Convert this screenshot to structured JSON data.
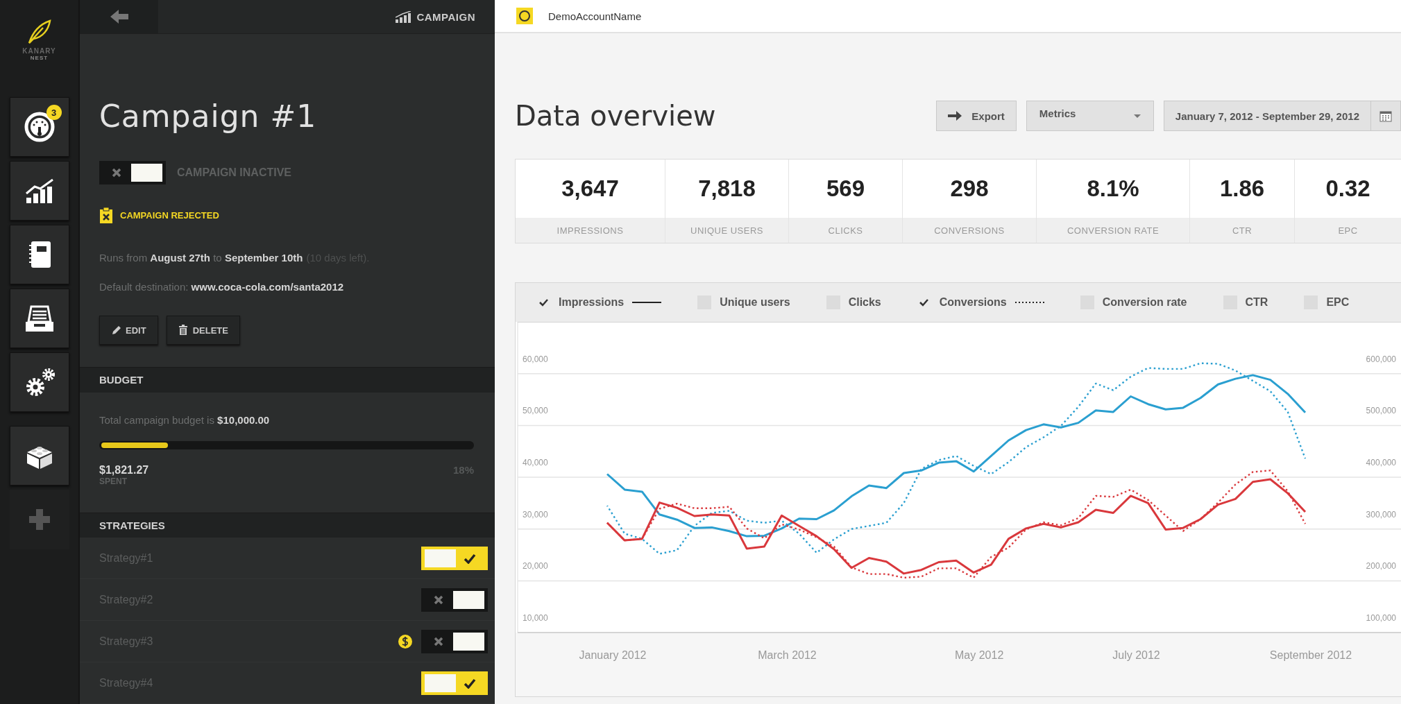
{
  "logo": {
    "line1": "KANARY",
    "line2": "NEST"
  },
  "nav": [
    {
      "kind": "dashboard",
      "badge": "3"
    },
    {
      "kind": "chart"
    },
    {
      "kind": "notebook"
    },
    {
      "kind": "inbox"
    },
    {
      "kind": "settings"
    },
    {
      "kind": "blocks"
    },
    {
      "kind": "add"
    }
  ],
  "panel": {
    "header_title": "CAMPAIGN",
    "title": "Campaign #1",
    "status": {
      "on": false,
      "label": "CAMPAIGN INACTIVE"
    },
    "rejected": "CAMPAIGN REJECTED",
    "runs": "Runs from **August 27th** to **September 10th**",
    "days_left": "(10 days left).",
    "destination": "Default destination: **www.coca-cola.com/santa2012**",
    "buttons": [
      {
        "kind": "edit",
        "label": "EDIT"
      },
      {
        "kind": "delete",
        "label": "DELETE"
      }
    ],
    "budget": {
      "heading": "BUDGET",
      "text": "Total campaign budget is **$10,000.00**",
      "level": 0.18,
      "spent": "$1,821.27",
      "spent_label": "SPENT",
      "percent": "18%"
    },
    "strategies_heading": "STRATEGIES",
    "strategies": [
      {
        "name": "Strategy#1",
        "on": true,
        "coin": false
      },
      {
        "name": "Strategy#2",
        "on": false,
        "coin": false
      },
      {
        "name": "Strategy#3",
        "on": false,
        "coin": true
      },
      {
        "name": "Strategy#4",
        "on": true,
        "coin": false
      }
    ]
  },
  "account": {
    "name": "DemoAccountName"
  },
  "overview": {
    "title": "Data overview",
    "export": "Export",
    "metrics": "Metrics",
    "date_range": "January 7, 2012 - September 29, 2012"
  },
  "stats": [
    {
      "value": "3,647",
      "label": "IMPRESSIONS"
    },
    {
      "value": "7,818",
      "label": "UNIQUE USERS"
    },
    {
      "value": "569",
      "label": "CLICKS"
    },
    {
      "value": "298",
      "label": "CONVERSIONS"
    },
    {
      "value": "8.1%",
      "label": "CONVERSION RATE"
    },
    {
      "value": "1.86",
      "label": "CTR"
    },
    {
      "value": "0.32",
      "label": "EPC"
    }
  ],
  "legend": [
    {
      "label": "Impressions",
      "checked": true,
      "kind": "solid"
    },
    {
      "label": "Unique users",
      "checked": false,
      "kind": "plain"
    },
    {
      "label": "Clicks",
      "checked": false,
      "kind": "plain"
    },
    {
      "label": "Conversions",
      "checked": true,
      "kind": "dotted"
    },
    {
      "label": "Conversion rate",
      "checked": false,
      "kind": "plain"
    },
    {
      "label": "CTR",
      "checked": false,
      "kind": "plain"
    },
    {
      "label": "EPC",
      "checked": false,
      "kind": "plain"
    }
  ],
  "right_axis_labels": [
    "600,000",
    "500,000",
    "400,000",
    "300,000",
    "200,000",
    "100,000"
  ],
  "chart_data": {
    "type": "line",
    "categories": [
      "January 2012",
      null,
      null,
      null,
      null,
      null,
      null,
      null,
      null,
      null,
      "March 2012",
      null,
      null,
      null,
      null,
      null,
      null,
      null,
      null,
      null,
      null,
      "May 2012",
      null,
      null,
      null,
      null,
      null,
      null,
      null,
      null,
      "July 2012",
      null,
      null,
      null,
      null,
      null,
      null,
      null,
      null,
      null,
      "September 2012"
    ],
    "ylim": [
      7200,
      67200
    ],
    "yticks": [
      {
        "value": 60000,
        "label": "60,000"
      },
      {
        "value": 50000,
        "label": "50,000"
      },
      {
        "value": 40000,
        "label": "40,000"
      },
      {
        "value": 30000,
        "label": "30,000"
      },
      {
        "value": 20000,
        "label": "20,000"
      },
      {
        "value": 10000,
        "label": "10,000"
      }
    ],
    "series": [
      {
        "color": "#2a9fd0",
        "line_style": "solid",
        "values": [
          37800,
          34800,
          34400,
          30000,
          29000,
          27400,
          27500,
          26800,
          25800,
          25900,
          27300,
          29200,
          29100,
          30800,
          33500,
          35600,
          35100,
          38000,
          38500,
          40000,
          40300,
          38300,
          41300,
          44300,
          46300,
          47400,
          46800,
          47700,
          50100,
          49800,
          52800,
          51300,
          50300,
          50600,
          52500,
          55100,
          56200,
          56900,
          56000,
          53300,
          49700
        ]
      },
      {
        "color": "#2a9fd0",
        "line_style": "dotted",
        "values": [
          31700,
          26300,
          25300,
          22400,
          23100,
          27800,
          30300,
          30700,
          28800,
          28400,
          28800,
          26300,
          22600,
          25200,
          27200,
          27800,
          28400,
          32200,
          38800,
          40500,
          41300,
          39400,
          37800,
          40100,
          43000,
          44900,
          47100,
          50800,
          55300,
          54000,
          56600,
          58300,
          58100,
          58100,
          59200,
          59100,
          57800,
          55800,
          53800,
          49800,
          40800
        ]
      },
      {
        "color": "#d9383c",
        "line_style": "solid",
        "values": [
          28400,
          25000,
          25300,
          32300,
          31300,
          29700,
          30000,
          29800,
          23400,
          23800,
          29800,
          27800,
          25800,
          23300,
          19700,
          21600,
          20900,
          18600,
          19300,
          20800,
          21100,
          18800,
          20300,
          25300,
          27300,
          28200,
          27500,
          28500,
          30900,
          30300,
          33600,
          32200,
          27100,
          27400,
          29100,
          31900,
          33000,
          36300,
          36800,
          34100,
          30500
        ]
      },
      {
        "color": "#d9383c",
        "line_style": "dotted",
        "values": [
          28400,
          25000,
          25300,
          31100,
          32100,
          31200,
          31200,
          31500,
          27300,
          25400,
          28100,
          27100,
          25600,
          23800,
          19800,
          18500,
          18500,
          17800,
          18000,
          19600,
          19600,
          17800,
          21800,
          23600,
          27100,
          28500,
          27900,
          29300,
          33600,
          33400,
          34800,
          32800,
          29800,
          26800,
          29100,
          32300,
          35800,
          38200,
          38500,
          34500,
          28200
        ]
      }
    ]
  }
}
